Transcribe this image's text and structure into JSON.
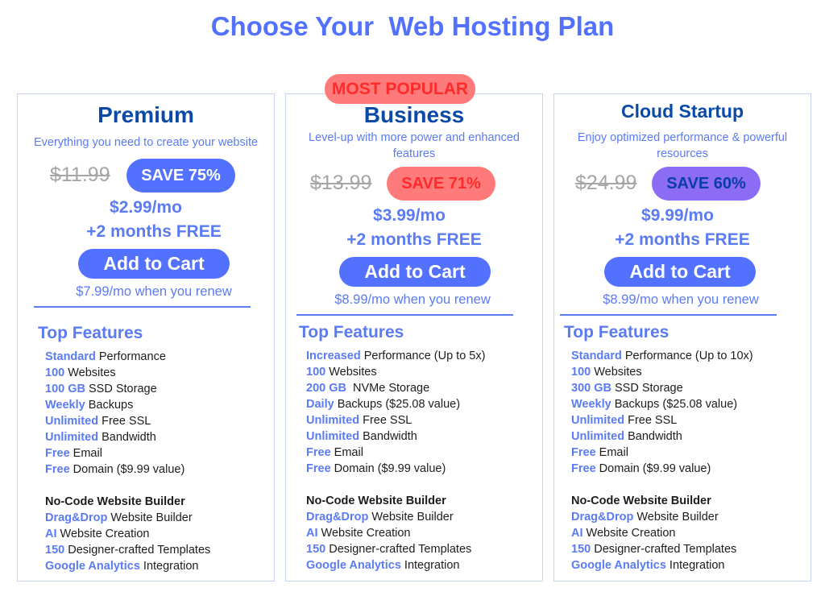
{
  "page": {
    "title": "Choose Your  Web Hosting Plan"
  },
  "colors": {
    "accent": "#5271ff",
    "plan_name": "#0a4aa6",
    "popular_bg": "#ff7a7a",
    "popular_text": "#ff2b2b",
    "cloud_save_bg": "#8c6cf5",
    "card_border": "#c8d2fb"
  },
  "popular_badge": "MOST POPULAR",
  "plans": [
    {
      "name": "Premium",
      "description": "Everything you need to create your website",
      "old_price": "$11.99",
      "save": "SAVE 75%",
      "price": "$2.99/mo",
      "bonus": "+2 months FREE",
      "cta": "Add to Cart",
      "renew": "$7.99/mo when you renew",
      "features_title": "Top Features",
      "features": [
        {
          "hl": "Standard",
          "rest": " Performance"
        },
        {
          "hl": "100",
          "rest": " Websites"
        },
        {
          "hl": "100 GB",
          "rest": " SSD Storage"
        },
        {
          "hl": "Weekly",
          "rest": " Backups"
        },
        {
          "hl": "Unlimited",
          "rest": " Free SSL"
        },
        {
          "hl": "Unlimited",
          "rest": " Bandwidth"
        },
        {
          "hl": "Free",
          "rest": " Email"
        },
        {
          "hl": "Free",
          "rest": " Domain ($9.99 value)"
        }
      ],
      "builder_title": "No-Code Website Builder",
      "builder": [
        {
          "hl": "Drag&Drop",
          "rest": " Website Builder"
        },
        {
          "hl": "AI",
          "rest": " Website Creation"
        },
        {
          "hl": "150",
          "rest": " Designer-crafted Templates"
        },
        {
          "hl": "Google Analytics",
          "rest": " Integration"
        }
      ]
    },
    {
      "name": "Business",
      "description": "Level-up with more power and enhanced features",
      "old_price": "$13.99",
      "save": "SAVE 71%",
      "price": "$3.99/mo",
      "bonus": "+2 months FREE",
      "cta": "Add to Cart",
      "renew": "$8.99/mo when you renew",
      "features_title": "Top Features",
      "features": [
        {
          "hl": "Increased",
          "rest": " Performance (Up to 5x)"
        },
        {
          "hl": "100",
          "rest": " Websites"
        },
        {
          "hl": "200 GB",
          "rest": "  NVMe Storage"
        },
        {
          "hl": "Daily",
          "rest": " Backups ($25.08 value)"
        },
        {
          "hl": "Unlimited",
          "rest": " Free SSL"
        },
        {
          "hl": "Unlimited",
          "rest": " Bandwidth"
        },
        {
          "hl": "Free",
          "rest": " Email"
        },
        {
          "hl": "Free",
          "rest": " Domain ($9.99 value)"
        }
      ],
      "builder_title": "No-Code Website Builder",
      "builder": [
        {
          "hl": "Drag&Drop",
          "rest": " Website Builder"
        },
        {
          "hl": "AI",
          "rest": " Website Creation"
        },
        {
          "hl": "150",
          "rest": " Designer-crafted Templates"
        },
        {
          "hl": "Google Analytics",
          "rest": " Integration"
        }
      ]
    },
    {
      "name": "Cloud Startup",
      "description": "Enjoy optimized performance & powerful resources",
      "old_price": "$24.99",
      "save": "SAVE 60%",
      "price": "$9.99/mo",
      "bonus": "+2 months FREE",
      "cta": "Add to Cart",
      "renew": "$8.99/mo when you renew",
      "features_title": "Top Features",
      "features": [
        {
          "hl": "Standard",
          "rest": " Performance (Up to 10x)"
        },
        {
          "hl": "100",
          "rest": " Websites"
        },
        {
          "hl": "300 GB",
          "rest": " SSD Storage"
        },
        {
          "hl": "Weekly",
          "rest": " Backups ($25.08 value)"
        },
        {
          "hl": "Unlimited",
          "rest": " Free SSL"
        },
        {
          "hl": "Unlimited",
          "rest": " Bandwidth"
        },
        {
          "hl": "Free",
          "rest": " Email"
        },
        {
          "hl": "Free",
          "rest": " Domain ($9.99 value)"
        }
      ],
      "builder_title": "No-Code Website Builder",
      "builder": [
        {
          "hl": "Drag&Drop",
          "rest": " Website Builder"
        },
        {
          "hl": "AI",
          "rest": " Website Creation"
        },
        {
          "hl": "150",
          "rest": " Designer-crafted Templates"
        },
        {
          "hl": "Google Analytics",
          "rest": " Integration"
        }
      ]
    }
  ]
}
